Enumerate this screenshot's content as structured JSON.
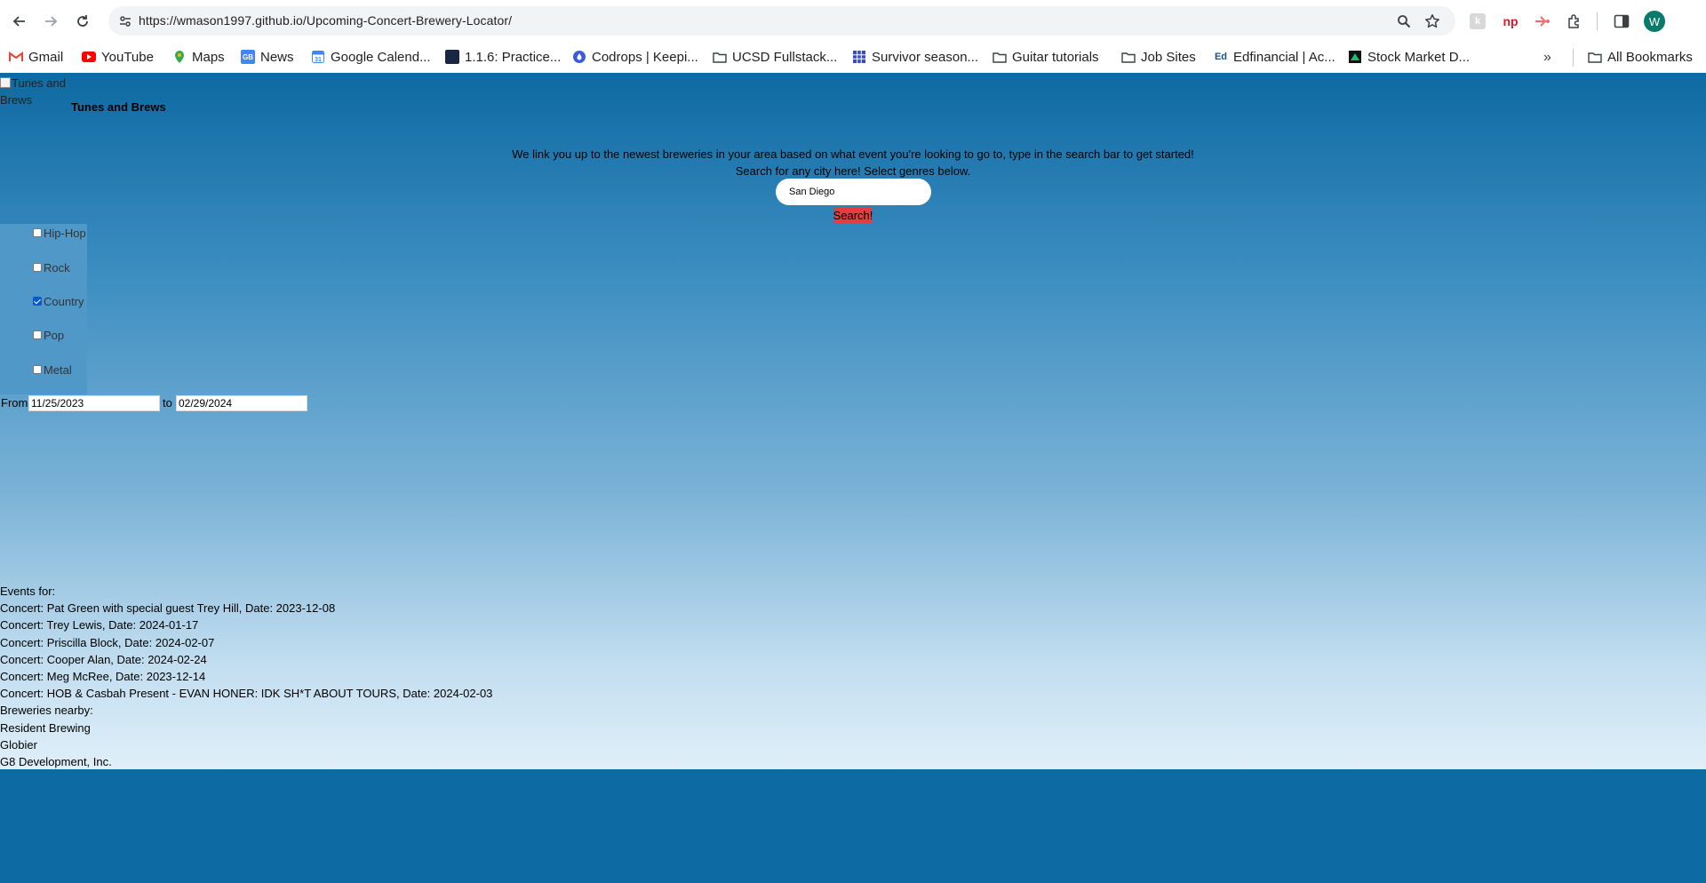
{
  "browser": {
    "url": "https://wmason1997.github.io/Upcoming-Concert-Brewery-Locator/",
    "avatar_letter": "W",
    "bookmarks": [
      {
        "label": "Gmail",
        "icon": "gmail-icon"
      },
      {
        "label": "YouTube",
        "icon": "youtube-icon"
      },
      {
        "label": "Maps",
        "icon": "maps-icon"
      },
      {
        "label": "News",
        "icon": "news-icon"
      },
      {
        "label": "Google Calend...",
        "icon": "calendar-icon"
      },
      {
        "label": "1.1.6: Practice...",
        "icon": "practice-icon"
      },
      {
        "label": "Codrops | Keepi...",
        "icon": "codrops-icon"
      },
      {
        "label": "UCSD Fullstack...",
        "icon": "folder-icon"
      },
      {
        "label": "Survivor season...",
        "icon": "grid-icon"
      },
      {
        "label": "Guitar tutorials",
        "icon": "folder-icon"
      },
      {
        "label": "Job Sites",
        "icon": "folder-icon"
      },
      {
        "label": "Edfinancial | Ac...",
        "icon": "edfinancial-icon"
      },
      {
        "label": "Stock Market D...",
        "icon": "stock-icon"
      }
    ],
    "all_bookmarks": "All Bookmarks"
  },
  "page": {
    "logo_alt": "Tunes and Brews",
    "title": "Tunes and Brews",
    "intro_line1": "We link you up to the newest breweries in your area based on what event you're looking to go to, type in the search bar to get started!",
    "intro_line2": "Search for any city here! Select genres below.",
    "city_value": "San Diego",
    "search_label": "Search!",
    "genres": [
      {
        "label": "Hip-Hop",
        "checked": false
      },
      {
        "label": "Rock",
        "checked": false
      },
      {
        "label": "Country",
        "checked": true
      },
      {
        "label": "Pop",
        "checked": false
      },
      {
        "label": "Metal",
        "checked": false
      }
    ],
    "from_label": "From",
    "to_label": "to",
    "from_date": "11/25/2023",
    "to_date": "02/29/2024",
    "events_heading": "Events for:",
    "events": [
      "Concert: Pat Green with special guest Trey Hill, Date: 2023-12-08",
      "Concert: Trey Lewis, Date: 2024-01-17",
      "Concert: Priscilla Block, Date: 2024-02-07",
      "Concert: Cooper Alan, Date: 2024-02-24",
      "Concert: Meg McRee, Date: 2023-12-14",
      "Concert: HOB & Casbah Present - EVAN HONER: IDK SH*T ABOUT TOURS, Date: 2024-02-03"
    ],
    "breweries_heading": "Breweries nearby:",
    "breweries": [
      "Resident Brewing",
      "Globier",
      "G8 Development, Inc."
    ]
  }
}
